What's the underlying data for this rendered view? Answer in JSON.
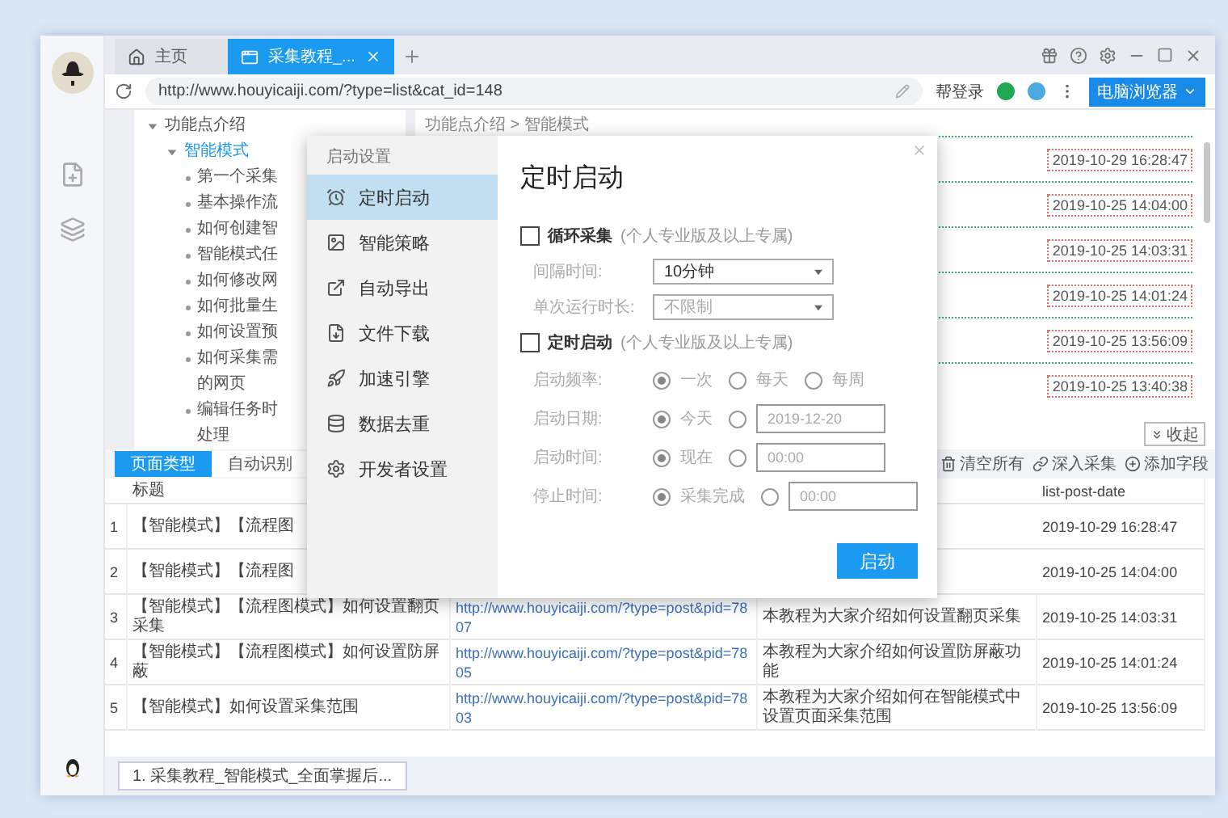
{
  "tabs": [
    {
      "label": "主页",
      "kind": "home",
      "selected": false
    },
    {
      "label": "采集教程_...",
      "kind": "page",
      "selected": true
    }
  ],
  "address_bar": {
    "url": "http://www.houyicaiji.com/?type=list&cat_id=148",
    "login": "帮登录",
    "browser_button": "电脑浏览器"
  },
  "tree": [
    {
      "label": "功能点介绍",
      "expanded": true,
      "selected": false,
      "children": [
        {
          "label": "智能模式",
          "expanded": true,
          "selected": true,
          "children": [
            {
              "label": "第一个采集"
            },
            {
              "label": "基本操作流"
            },
            {
              "label": "如何创建智"
            },
            {
              "label": "智能模式任"
            },
            {
              "label": "如何修改网"
            },
            {
              "label": "如何批量生"
            },
            {
              "label": "如何设置预"
            },
            {
              "label": "如何采集需",
              "continuation": "的网页"
            },
            {
              "label": "编辑任务时",
              "continuation": "处理"
            }
          ]
        }
      ]
    }
  ],
  "page": {
    "breadcrumb": "功能点介绍 > 智能模式",
    "dates": [
      "2019-10-29 16:28:47",
      "2019-10-25 14:04:00",
      "2019-10-25 14:03:31",
      "2019-10-25 14:01:24",
      "2019-10-25 13:56:09",
      "2019-10-25 13:40:38"
    ],
    "collapse_button": "收起"
  },
  "dialog": {
    "header": "启动设置",
    "nav": [
      {
        "label": "定时启动",
        "selected": true
      },
      {
        "label": "智能策略",
        "selected": false
      },
      {
        "label": "自动导出",
        "selected": false
      },
      {
        "label": "文件下载",
        "selected": false
      },
      {
        "label": "加速引擎",
        "selected": false
      },
      {
        "label": "数据去重",
        "selected": false
      },
      {
        "label": "开发者设置",
        "selected": false
      }
    ],
    "title": "定时启动",
    "sections": [
      {
        "label": "循环采集",
        "note": "(个人专业版及以上专属)",
        "checked": false,
        "fields": [
          {
            "kind": "select",
            "label": "间隔时间:",
            "value": "10分钟",
            "disabled": false
          },
          {
            "kind": "select",
            "label": "单次运行时长:",
            "value": "不限制",
            "disabled": true
          }
        ]
      },
      {
        "label": "定时启动",
        "note": "(个人专业版及以上专属)",
        "checked": false,
        "fields": [
          {
            "kind": "radios",
            "label": "启动频率:",
            "options": [
              {
                "label": "一次",
                "selected": true
              },
              {
                "label": "每天",
                "selected": false
              },
              {
                "label": "每周",
                "selected": false
              }
            ]
          },
          {
            "kind": "radios",
            "label": "启动日期:",
            "options": [
              {
                "label": "今天",
                "selected": true
              },
              {
                "selected": false,
                "input": "2019-12-20"
              }
            ]
          },
          {
            "kind": "radios",
            "label": "启动时间:",
            "options": [
              {
                "label": "现在",
                "selected": true
              },
              {
                "selected": false,
                "input": "00:00"
              }
            ]
          },
          {
            "kind": "radios",
            "label": "停止时间:",
            "options": [
              {
                "label": "采集完成",
                "selected": true
              },
              {
                "selected": false,
                "input": "00:00"
              }
            ]
          }
        ]
      }
    ],
    "submit": "启动"
  },
  "bottom_panel": {
    "tabs": [
      {
        "label": "页面类型",
        "selected": true
      },
      {
        "label": "自动识别",
        "selected": false
      }
    ],
    "actions": [
      "清空所有",
      "深入采集",
      "添加字段"
    ],
    "columns": {
      "title": "标题",
      "date": "list-post-date"
    },
    "rows": [
      {
        "number": "1",
        "title": "【智能模式】【流程图",
        "date": "2019-10-29 16:28:47"
      },
      {
        "number": "2",
        "title": "【智能模式】【流程图",
        "date": "2019-10-25 14:04:00"
      },
      {
        "number": "3",
        "title": "【智能模式】【流程图模式】如何设置翻页采集",
        "link": "http://www.houyicaiji.com/?type=post&pid=7807",
        "description": "本教程为大家介绍如何设置翻页采集",
        "date": "2019-10-25 14:03:31"
      },
      {
        "number": "4",
        "title": "【智能模式】【流程图模式】如何设置防屏蔽",
        "link": "http://www.houyicaiji.com/?type=post&pid=7805",
        "description": "本教程为大家介绍如何设置防屏蔽功能",
        "date": "2019-10-25 14:01:24"
      },
      {
        "number": "5",
        "title": "【智能模式】如何设置采集范围",
        "link": "http://www.houyicaiji.com/?type=post&pid=7803",
        "description": "本教程为大家介绍如何在智能模式中设置页面采集范围",
        "date": "2019-10-25 13:56:09"
      }
    ]
  },
  "status_bar": {
    "task_tab": "1. 采集教程_智能模式_全面掌握后..."
  }
}
